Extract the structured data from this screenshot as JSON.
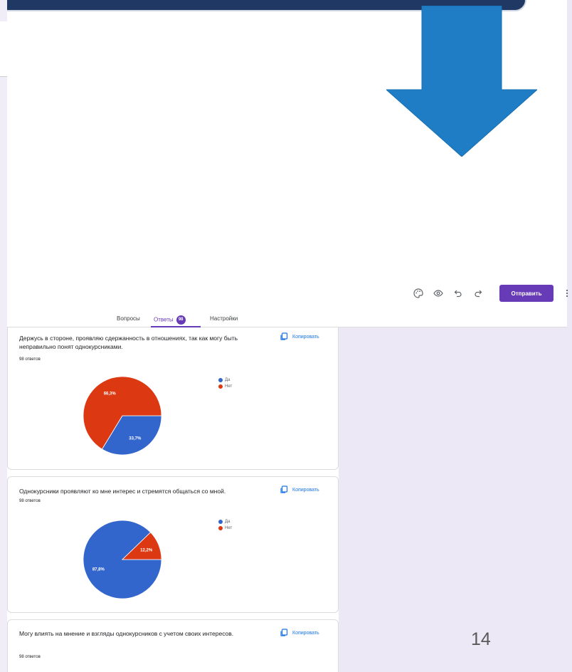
{
  "toolbar": {
    "icons": [
      "palette-icon",
      "eye-icon",
      "undo-icon",
      "redo-icon"
    ],
    "send_label": "Отправить",
    "more_icon": "more-vert-icon"
  },
  "tabs": {
    "questions": "Вопросы",
    "responses": "Ответы",
    "responses_count": "98",
    "settings": "Настройки"
  },
  "colors": {
    "accent": "#673ab7",
    "yes": "#3366cc",
    "no": "#dc3912",
    "arrow": "#1f7dc6"
  },
  "questions": [
    {
      "text": "Держусь в стороне, проявляю сдержанность в отношениях, так как могу быть неправильно понят однокурсниками.",
      "responses": "98 ответов",
      "copy_label": "Копировать"
    },
    {
      "text": "Однокурсники проявляют ко мне интерес и стремятся общаться со мной.",
      "responses": "98 ответов",
      "copy_label": "Копировать"
    },
    {
      "text": "Могу влиять на мнение и взгляды однокурсников с учетом своих интересов.",
      "responses": "98 ответов",
      "copy_label": "Копировать"
    }
  ],
  "legend": {
    "yes": "Да",
    "no": "Нет"
  },
  "chart_data": [
    {
      "type": "pie",
      "categories": [
        "Да",
        "Нет"
      ],
      "values": [
        33.7,
        66.3
      ],
      "labels": [
        "33,7%",
        "66,3%"
      ]
    },
    {
      "type": "pie",
      "categories": [
        "Да",
        "Нет"
      ],
      "values": [
        87.8,
        12.2
      ],
      "labels": [
        "87,8%",
        "12,2%"
      ]
    }
  ],
  "slide": {
    "page_number": "14"
  }
}
